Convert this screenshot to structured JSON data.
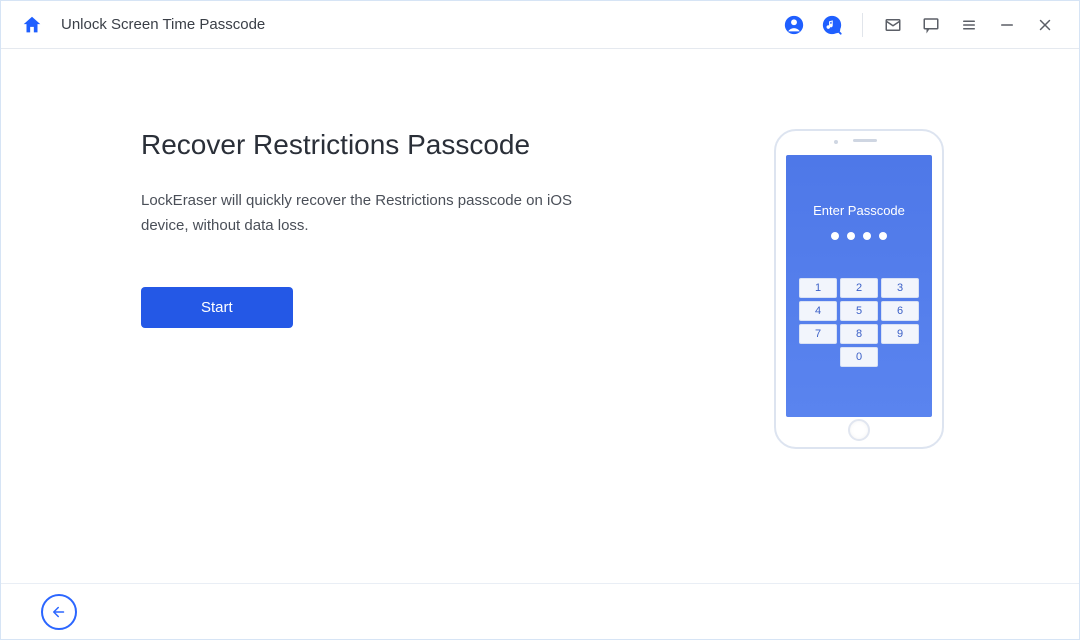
{
  "header": {
    "title": "Unlock Screen Time Passcode"
  },
  "main": {
    "heading": "Recover Restrictions Passcode",
    "description": "LockEraser will quickly recover the Restrictions passcode on iOS device, without data loss.",
    "start_label": "Start"
  },
  "phone": {
    "screen_text": "Enter Passcode",
    "keys": [
      "1",
      "2",
      "3",
      "4",
      "5",
      "6",
      "7",
      "8",
      "9",
      "0"
    ]
  }
}
